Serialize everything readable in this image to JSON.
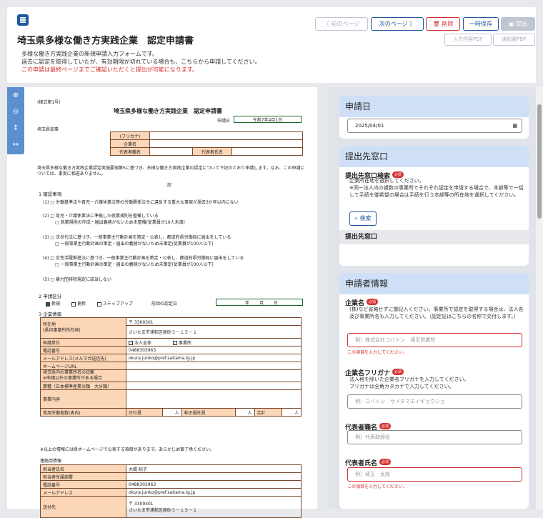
{
  "header": {
    "title": "埼玉県多様な働き方実践企業　認定申請書",
    "desc1": "多様な働き方実践企業の新規申請入力フォームです。",
    "desc2": "過去に認定を取得していたが、有効期限が切れている場合も、こちらから申請してください。",
    "note": "この申請は最終ページまでご確認いただくと提出が可能になります。"
  },
  "buttons": {
    "prev": "〈 前のページ",
    "next": "次のページ 〉",
    "delete": "削除",
    "save": "一時保存",
    "submit": "提出",
    "input_pdf": "入力内容PDF",
    "notice_pdf": "通知書PDF"
  },
  "doc": {
    "form_no": "(様式第1号)",
    "title": "埼玉県多様な働き方実践企業　認定申請書",
    "date_label": "申請日",
    "date_val": "令和7年4月1日",
    "to": "埼玉県知事",
    "furigana": "(フリガナ)",
    "company": "企業名",
    "rep_title": "代表者職名",
    "rep_name": "代表者氏名",
    "intro": "埼玉県多様な働き方実践企業認定実施要領第5に基づき、多様な働き方実践企業の認定について下記のとおり申請します。なお、この申請については、事実に相違ありません。",
    "ki": "記",
    "s1": "1 確認事項",
    "c1": "(1) □ 労働基準法や育児・介護休業法等の労働関係法令に違反する重大な事案が過去3か年以内にない",
    "c2": "(2) □ 育児・介護休業法に準拠した就業規則を整備している",
    "c2b": "□ 就業規則の作成・届出義務がないため未整備(従業員が10人未満)",
    "c3": "(3) □ 次世代法に基づき、一般事業主行動計画を策定・公表し、都道府県労働局に届出をしている",
    "c3b": "□ 一般事業主行動計画の策定・届出の義務がないため未策定(従業員が100人以下)",
    "c4": "(4) □ 女性活躍推進法に基づき、一般事業主行動計画を策定・公表し、都道府県労働局に届出をしている",
    "c4b": "□ 一般事業主行動計画の策定・届出の義務がないため未策定(従業員が100人以下)",
    "c5": "(5) □ 暴力団排除規定に該当しない",
    "s2": "2 申請区分",
    "k1": "新規",
    "k2": "更新",
    "k3": "ステップアップ",
    "prev_date": "前回の認定日",
    "nen": "年",
    "tsuki": "月",
    "hi": "日",
    "s3": "3 企業情報",
    "zip": "〒 3309301",
    "loc_l1": "所在地",
    "loc_l2": "(県内事業所所在地)",
    "addr": "さいたま市浦和区高砂３－１５－１",
    "unit_l": "申請単位",
    "unit1": "法人全体",
    "unit2": "事業所",
    "tel_l": "電話番号",
    "tel": "0488303963",
    "mail_l": "メールアドレス(メルマガ送信先)",
    "mail": "okura.junko@pref.saitama.lg.jp",
    "hp": "ホームページURL",
    "branch_l1": "埼玉県内の事業所名の記載",
    "branch_l2": "※申請以外の事業所がある場合",
    "industry": "業種（日本標準産業分類　大分類）",
    "business": "事業内容",
    "emp": "常用労働者数(表内)",
    "emp1": "正社員",
    "emp2": "非正規社員",
    "emp3": "合計",
    "nin": "人",
    "note": "※以上の情報には県ホームページで公表する項目があります。あらかじめ御了承ください。",
    "s4": "連絡用情報",
    "p1": "担当者氏名",
    "p1v": "大蔵 純子",
    "p2": "担当者所属部署",
    "p3": "電話番号",
    "p3v": "0488303963",
    "p4": "メールアドレス",
    "p4v": "okura.junko@pref.saitama.lg.jp",
    "p5": "送付先",
    "p5z": "〒 3309301",
    "p5v": "さいたま市浦和区高砂３－１５－１"
  },
  "panel": {
    "date_h": "申請日",
    "date_v": "2025/04/01",
    "win_h": "提出先窓口",
    "win_search_l": "提出先窓口検索",
    "req": "必須",
    "win_desc": "企業所在地を選択してください。\n※同一法人内の複数の事業所でそれぞれ認定を申請する場合で、本部等で一括して手続を御希望の場合は手続を行う本部等の所在地を選択してください。",
    "search_btn": "検索",
    "win_l2": "提出先窓口",
    "app_h": "申請者情報",
    "co_l": "企業名",
    "co_desc": "(株)など省略せずに御記入ください。事業所で認定を取得する場合は、法人名及び事業所名も入力してください。（認定証はこちらの名称で交付します。）",
    "co_ph": "例）株式会社コバトン　埼玉営業所",
    "err": "この項目を入力してください。",
    "kana_l": "企業名フリガナ",
    "kana_desc": "法人格を除いた企業名フリガナを入力してください。\nフリガナは全角カタカナで入力してください。",
    "kana_ph": "例）コバトン　サイタマエイギョウショ",
    "rt_l": "代表者職名",
    "rt_ph": "例）代表取締役",
    "rn_l": "代表者氏名",
    "rn_ph": "例）埼玉　太郎"
  }
}
